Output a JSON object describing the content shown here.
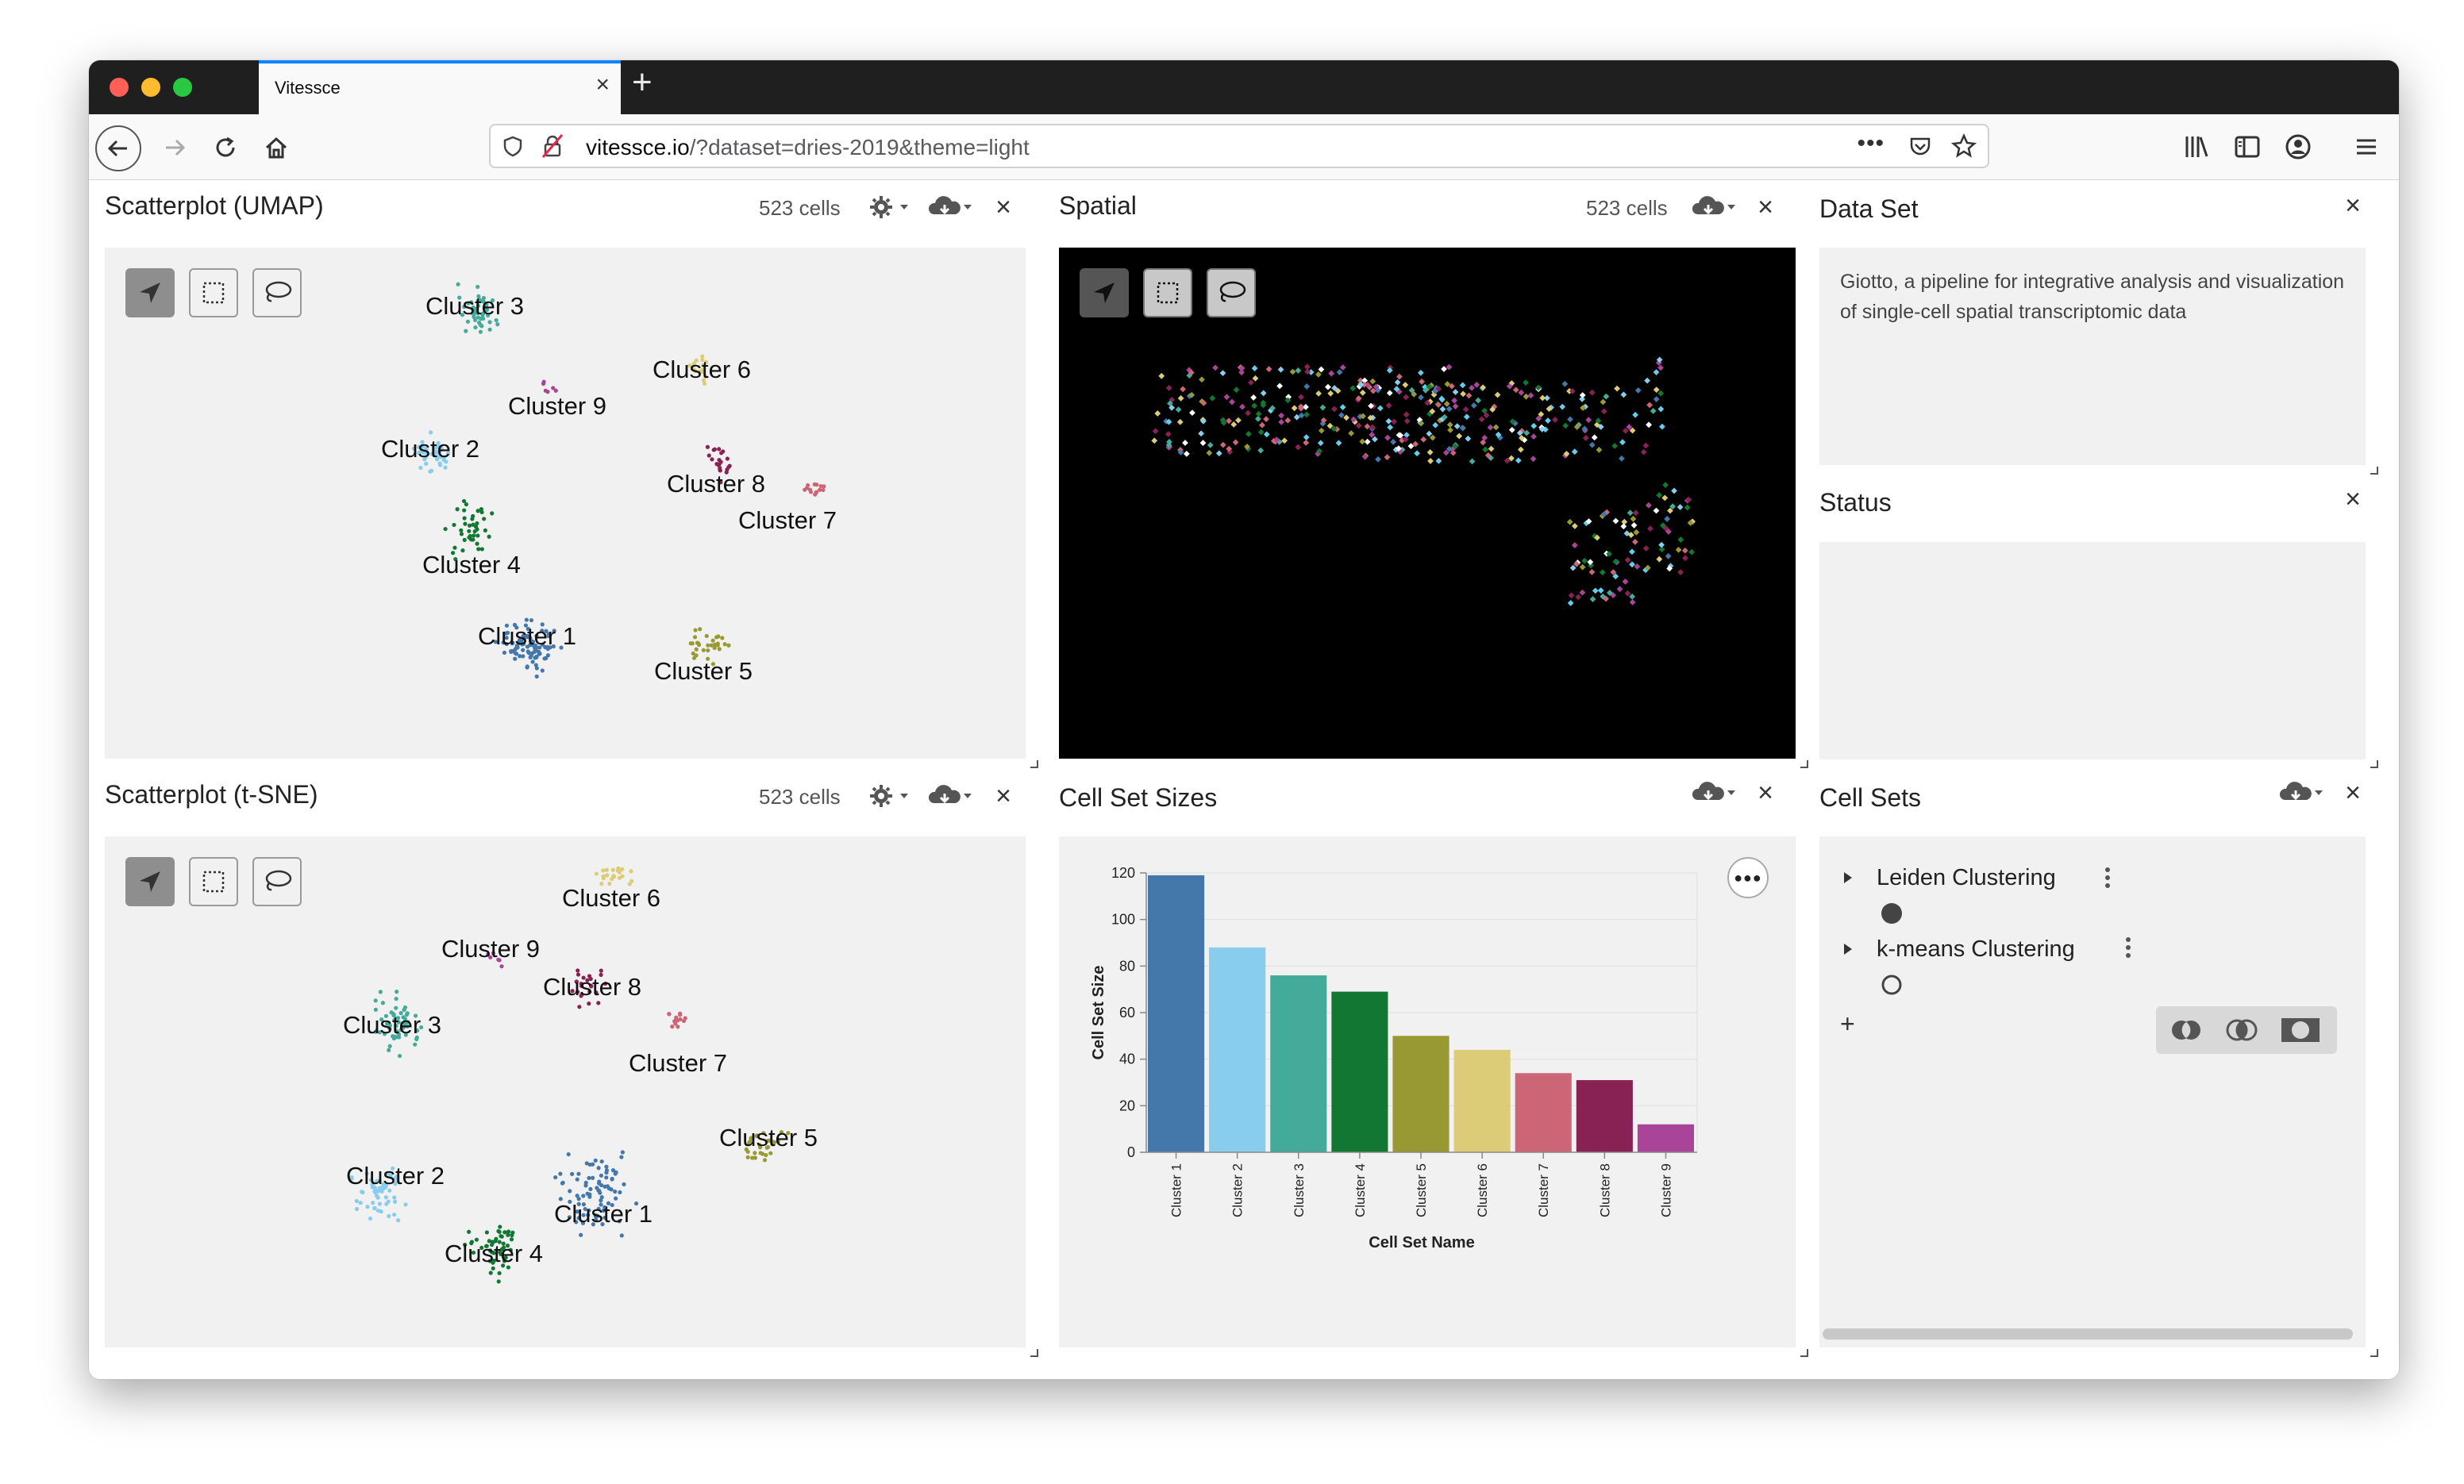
{
  "browser": {
    "tab_title": "Vitessce",
    "url_host": "vitessce.io",
    "url_path": "/?dataset=dries-2019&theme=light"
  },
  "umap": {
    "title": "Scatterplot (UMAP)",
    "cell_count": "523 cells",
    "clusters": [
      "Cluster 3",
      "Cluster 6",
      "Cluster 9",
      "Cluster 2",
      "Cluster 8",
      "Cluster 7",
      "Cluster 4",
      "Cluster 1",
      "Cluster 5"
    ]
  },
  "spatial": {
    "title": "Spatial",
    "cell_count": "523 cells"
  },
  "dataset": {
    "title": "Data Set",
    "description": "Giotto, a pipeline for integrative analysis and visualization of single-cell spatial transcriptomic data"
  },
  "status": {
    "title": "Status"
  },
  "tsne": {
    "title": "Scatterplot (t-SNE)",
    "cell_count": "523 cells",
    "clusters": [
      "Cluster 6",
      "Cluster 9",
      "Cluster 8",
      "Cluster 3",
      "Cluster 7",
      "Cluster 5",
      "Cluster 2",
      "Cluster 1",
      "Cluster 4"
    ]
  },
  "cell_set_sizes": {
    "title": "Cell Set Sizes"
  },
  "cell_sets": {
    "title": "Cell Sets",
    "hierarchies": [
      {
        "name": "Leiden Clustering",
        "selected": true
      },
      {
        "name": "k-means Clustering",
        "selected": false
      }
    ],
    "add_label": "+"
  },
  "colors": {
    "accent": "#0a84ff",
    "cluster_colors": [
      "#4477aa",
      "#88ccee",
      "#44aa99",
      "#117733",
      "#999933",
      "#ddcc77",
      "#cc6677",
      "#882255",
      "#aa4499"
    ]
  },
  "chart_data": {
    "type": "bar",
    "title": "",
    "xlabel": "Cell Set Name",
    "ylabel": "Cell Set Size",
    "categories": [
      "Cluster 1",
      "Cluster 2",
      "Cluster 3",
      "Cluster 4",
      "Cluster 5",
      "Cluster 6",
      "Cluster 7",
      "Cluster 8",
      "Cluster 9"
    ],
    "values": [
      119,
      88,
      76,
      69,
      50,
      44,
      34,
      31,
      12
    ],
    "colors": [
      "#4477aa",
      "#88ccee",
      "#44aa99",
      "#117733",
      "#999933",
      "#ddcc77",
      "#cc6677",
      "#882255",
      "#aa4499"
    ],
    "yticks": [
      0,
      20,
      40,
      60,
      80,
      100,
      120
    ],
    "ylim": [
      0,
      120
    ],
    "grid": true,
    "legend": "none"
  }
}
